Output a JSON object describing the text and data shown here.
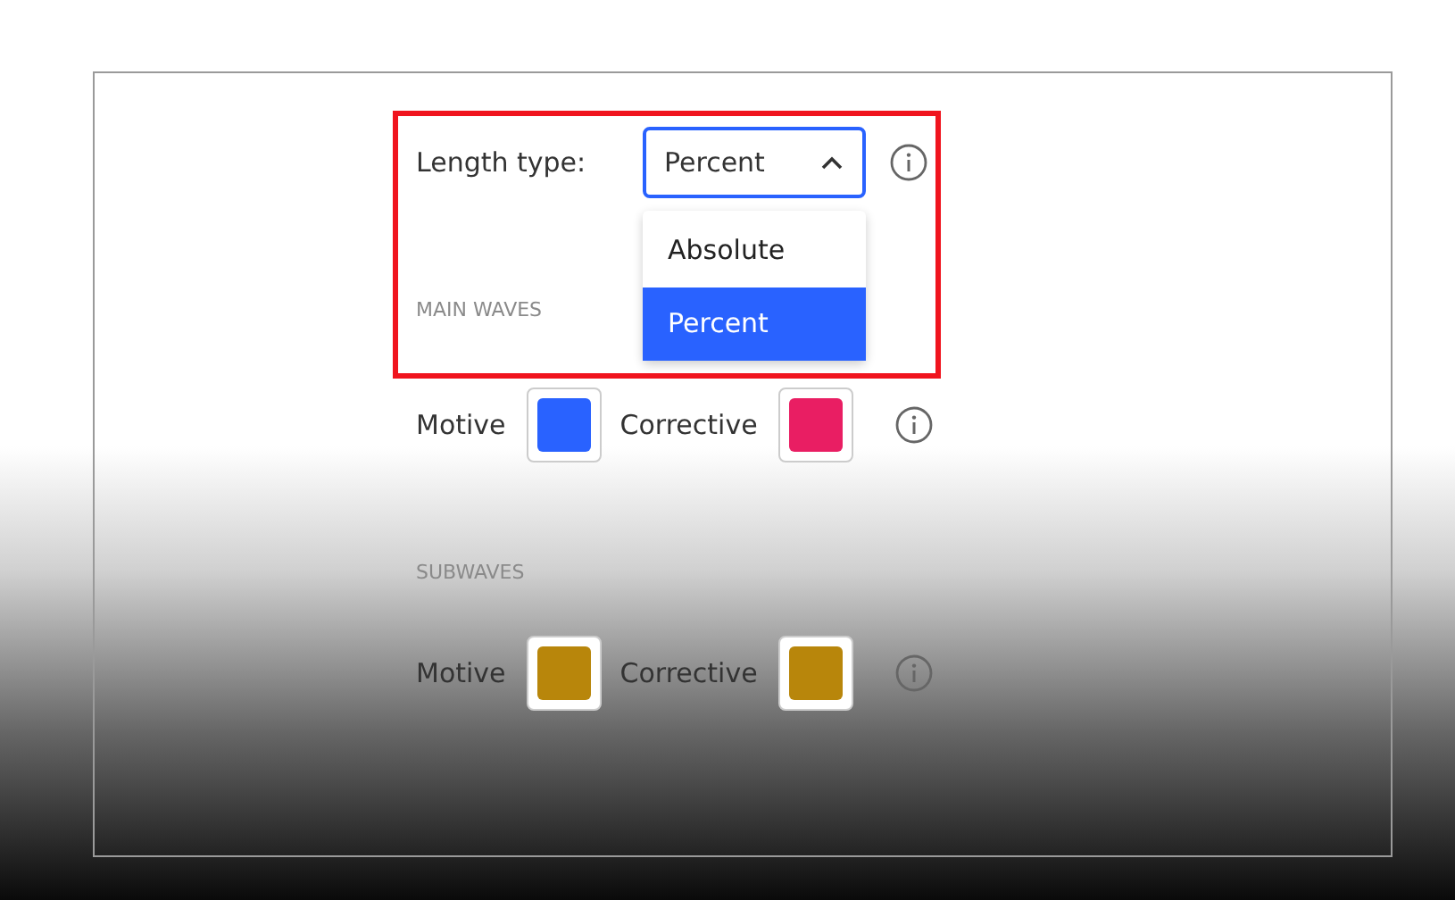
{
  "length_type": {
    "label": "Length type:",
    "value": "Percent",
    "expanded": true,
    "options": [
      {
        "label": "Absolute",
        "selected": false
      },
      {
        "label": "Percent",
        "selected": true
      }
    ]
  },
  "sections": [
    {
      "title": "MAIN WAVES",
      "colors": [
        {
          "label": "Motive",
          "color": "#2962ff"
        },
        {
          "label": "Corrective",
          "color": "#e91e63"
        }
      ]
    },
    {
      "title": "SUBWAVES",
      "colors": [
        {
          "label": "Motive",
          "color": "#b8860b"
        },
        {
          "label": "Corrective",
          "color": "#b8860b"
        }
      ]
    }
  ]
}
